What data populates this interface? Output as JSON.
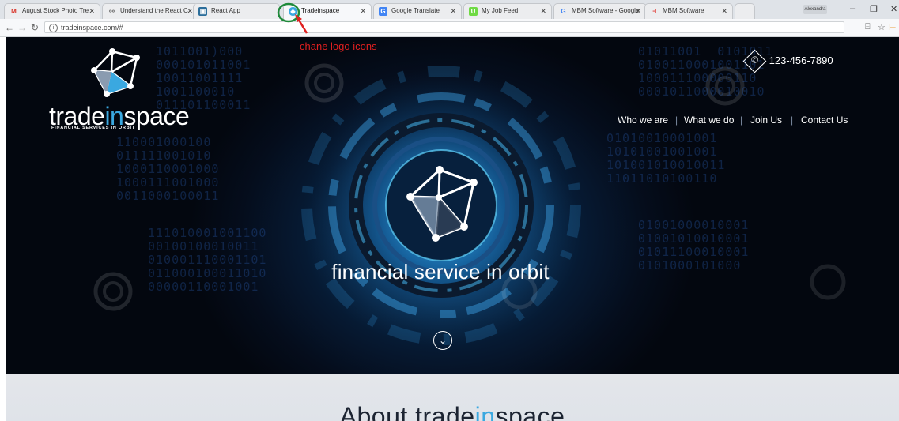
{
  "browser": {
    "tabs": [
      {
        "title": "August Stock Photo Tre",
        "icon": "gmail-icon",
        "color": "#d93025"
      },
      {
        "title": "Understand the React C",
        "icon": "link-icon",
        "color": "#777777"
      },
      {
        "title": "React App",
        "icon": "react-app-icon",
        "color": "#2c6e9b"
      },
      {
        "title": "Tradeinspace",
        "icon": "site-icon",
        "color": "#3aa8e0"
      },
      {
        "title": "Google Translate",
        "icon": "translate-icon",
        "color": "#4285f4"
      },
      {
        "title": "My Job Feed",
        "icon": "upwork-icon",
        "color": "#6fda44"
      },
      {
        "title": "MBM Software - Google",
        "icon": "google-icon",
        "color": "#4285f4"
      },
      {
        "title": "MBM Software",
        "icon": "mbm-icon",
        "color": "#e0302a"
      }
    ],
    "url": "tradeinspace.com/#",
    "profile": "Alexandra"
  },
  "annotation": {
    "text": "chane logo icons",
    "color": "#e02020"
  },
  "header": {
    "phone": "123-456-7890",
    "brand_prefix": "trade",
    "brand_highlight": "in",
    "brand_suffix": "space",
    "brand_tagline": "FINANCIAL SERVICES IN ORBIT",
    "nav": [
      "Who we are",
      "What we do",
      "Join Us",
      "Contact Us"
    ]
  },
  "hero": {
    "title": "financial service in orbit"
  },
  "about": {
    "title_prefix": "About trade",
    "title_highlight": "in",
    "title_suffix": "space"
  },
  "colors": {
    "accent": "#3aa8e0",
    "hero_bg": "#050d1c",
    "annotation": "#e02020"
  }
}
